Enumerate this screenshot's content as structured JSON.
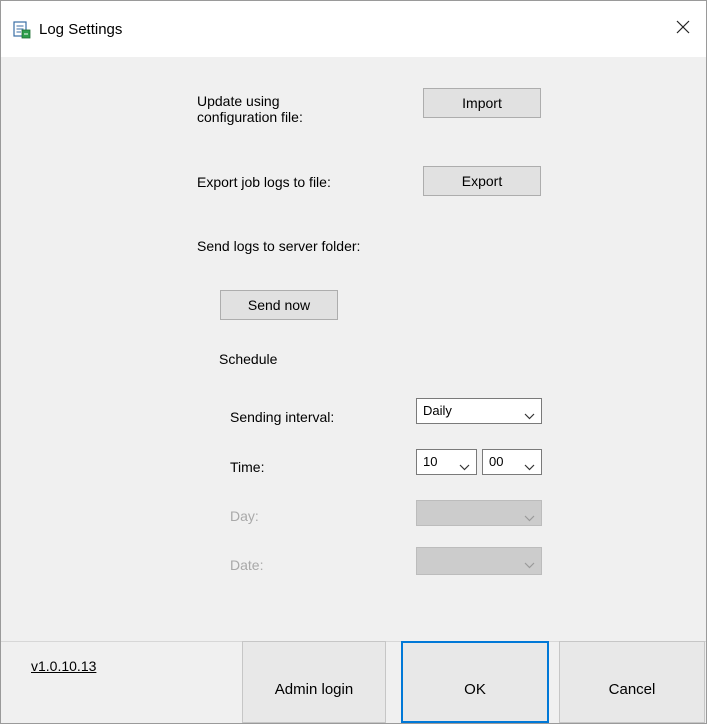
{
  "window": {
    "title": "Log Settings",
    "icon": "log-settings-icon",
    "close_icon": "close-icon"
  },
  "import": {
    "label": "Update using\nconfiguration file:",
    "button": "Import"
  },
  "export": {
    "label": "Export job logs to file:",
    "button": "Export"
  },
  "send": {
    "label": "Send logs to server folder:",
    "send_now": "Send now",
    "schedule_label": "Schedule",
    "interval_label": "Sending interval:",
    "interval_value": "Daily",
    "time_label": "Time:",
    "time_hour": "10",
    "time_minute": "00",
    "day_label": "Day:",
    "day_value": "",
    "date_label": "Date:",
    "date_value": ""
  },
  "footer": {
    "version": "v1.0.10.13",
    "admin_login": "Admin login",
    "ok": "OK",
    "cancel": "Cancel"
  }
}
